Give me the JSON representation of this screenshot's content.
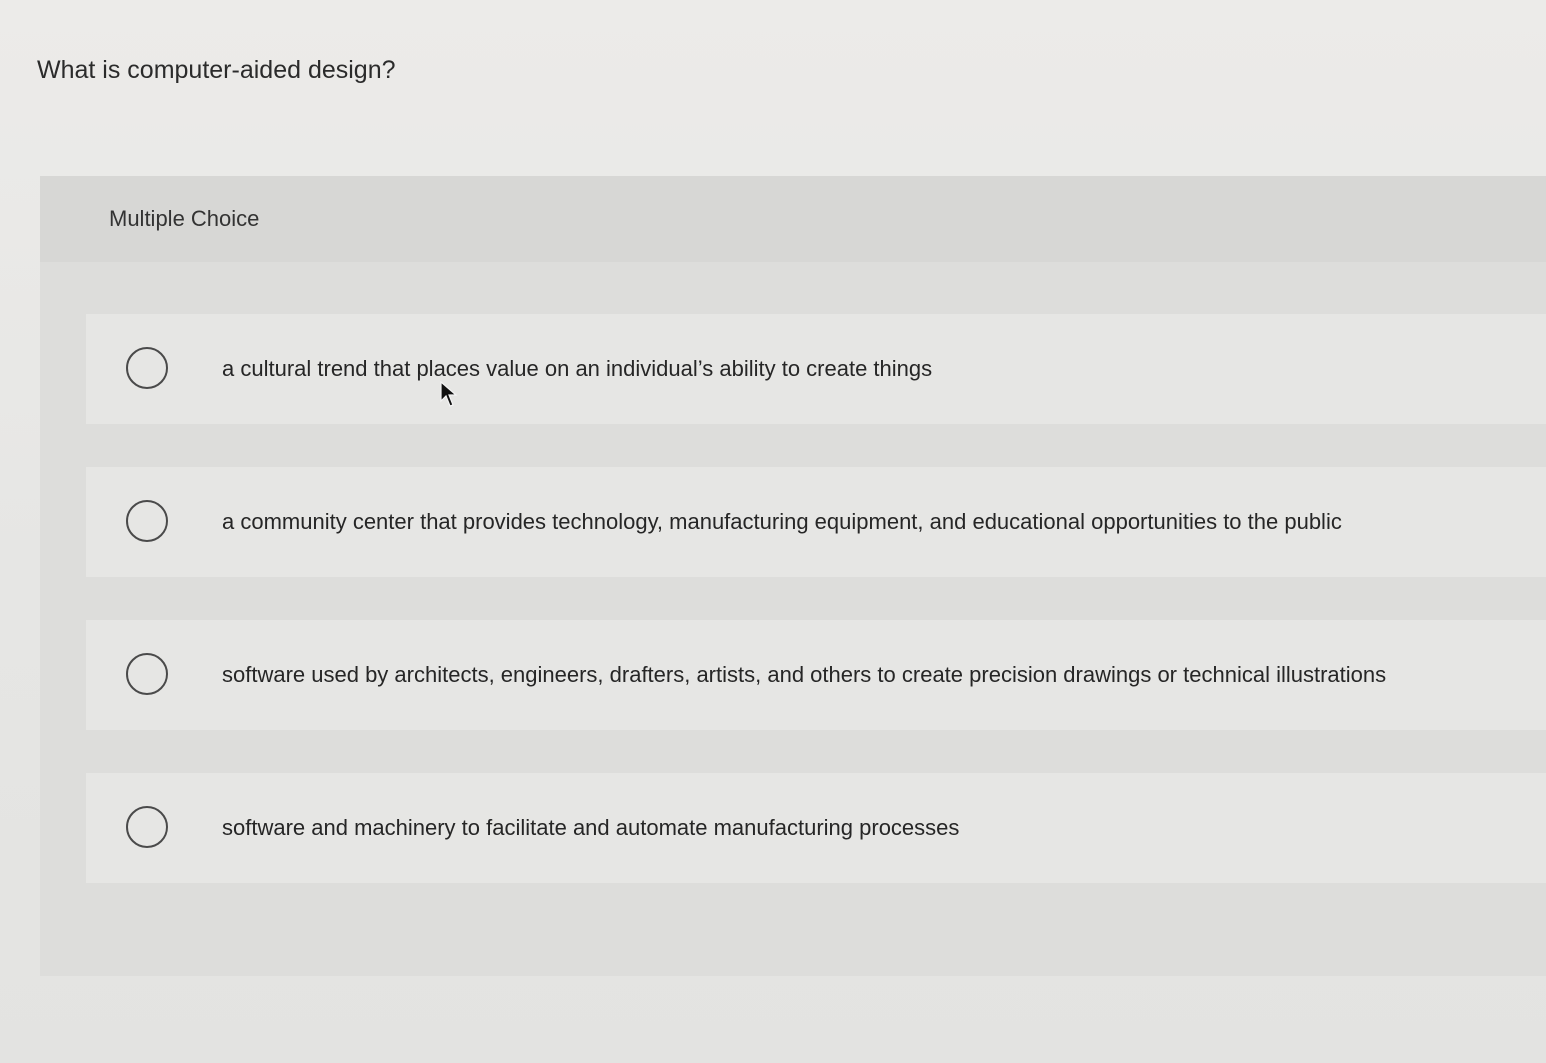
{
  "question": {
    "text": "What is computer-aided design?"
  },
  "multiple_choice": {
    "label": "Multiple Choice",
    "options": [
      {
        "text": "a cultural trend that places value on an individual’s ability to create things"
      },
      {
        "text": "a community center that provides technology, manufacturing equipment, and educational opportunities to the public"
      },
      {
        "text": "software used by architects, engineers, drafters, artists, and others to create precision drawings or technical illustrations"
      },
      {
        "text": "software and machinery to facilitate and automate manufacturing processes"
      }
    ]
  },
  "colors": {
    "background": "#e9e9e7",
    "panel": "#dddddb",
    "option_background": "#e6e6e4",
    "text": "#262626",
    "radio_border": "#4a4a4a"
  },
  "icons": {
    "cursor": "mouse-pointer-icon",
    "radio": "radio-button-unchecked-icon"
  }
}
